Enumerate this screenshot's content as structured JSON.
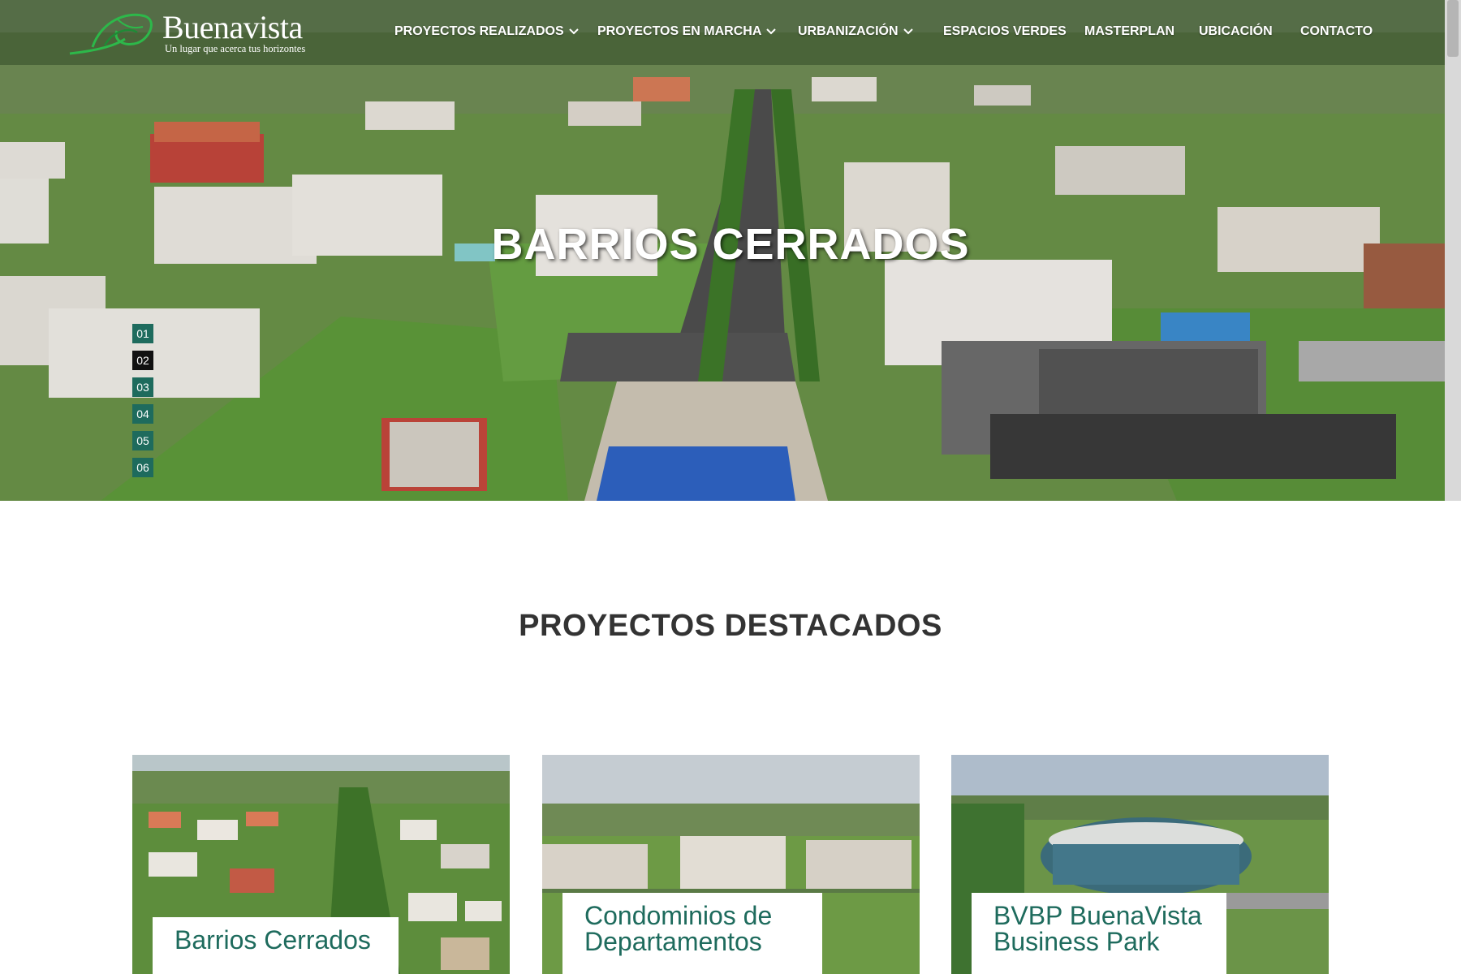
{
  "brand": {
    "name": "Buenavista",
    "tagline": "Un lugar que acerca tus horizontes"
  },
  "nav": {
    "items": [
      {
        "label": "PROYECTOS REALIZADOS",
        "dropdown": true
      },
      {
        "label": "PROYECTOS EN MARCHA",
        "dropdown": true
      },
      {
        "label": "URBANIZACIÓN",
        "dropdown": true
      },
      {
        "label": "ESPACIOS VERDES",
        "dropdown": false
      },
      {
        "label": "MASTERPLAN",
        "dropdown": false
      },
      {
        "label": "UBICACIÓN",
        "dropdown": false
      },
      {
        "label": "CONTACTO",
        "dropdown": false
      }
    ]
  },
  "hero": {
    "title": "BARRIOS CERRADOS",
    "slides": [
      "01",
      "02",
      "03",
      "04",
      "05",
      "06"
    ],
    "active_slide": "02"
  },
  "featured": {
    "title": "PROYECTOS DESTACADOS",
    "cards": [
      {
        "label_line1": "Barrios Cerrados",
        "label_line2": ""
      },
      {
        "label_line1": "Condominios de",
        "label_line2": "Departamentos"
      },
      {
        "label_line1": "BVBP BuenaVista",
        "label_line2": "Business Park"
      }
    ]
  },
  "colors": {
    "accent": "#1e6b5d",
    "slide_active": "#111111",
    "heading": "#333333"
  },
  "icons": {
    "logo": "buenavista-logo-icon",
    "dropdown": "chevron-down-icon"
  }
}
